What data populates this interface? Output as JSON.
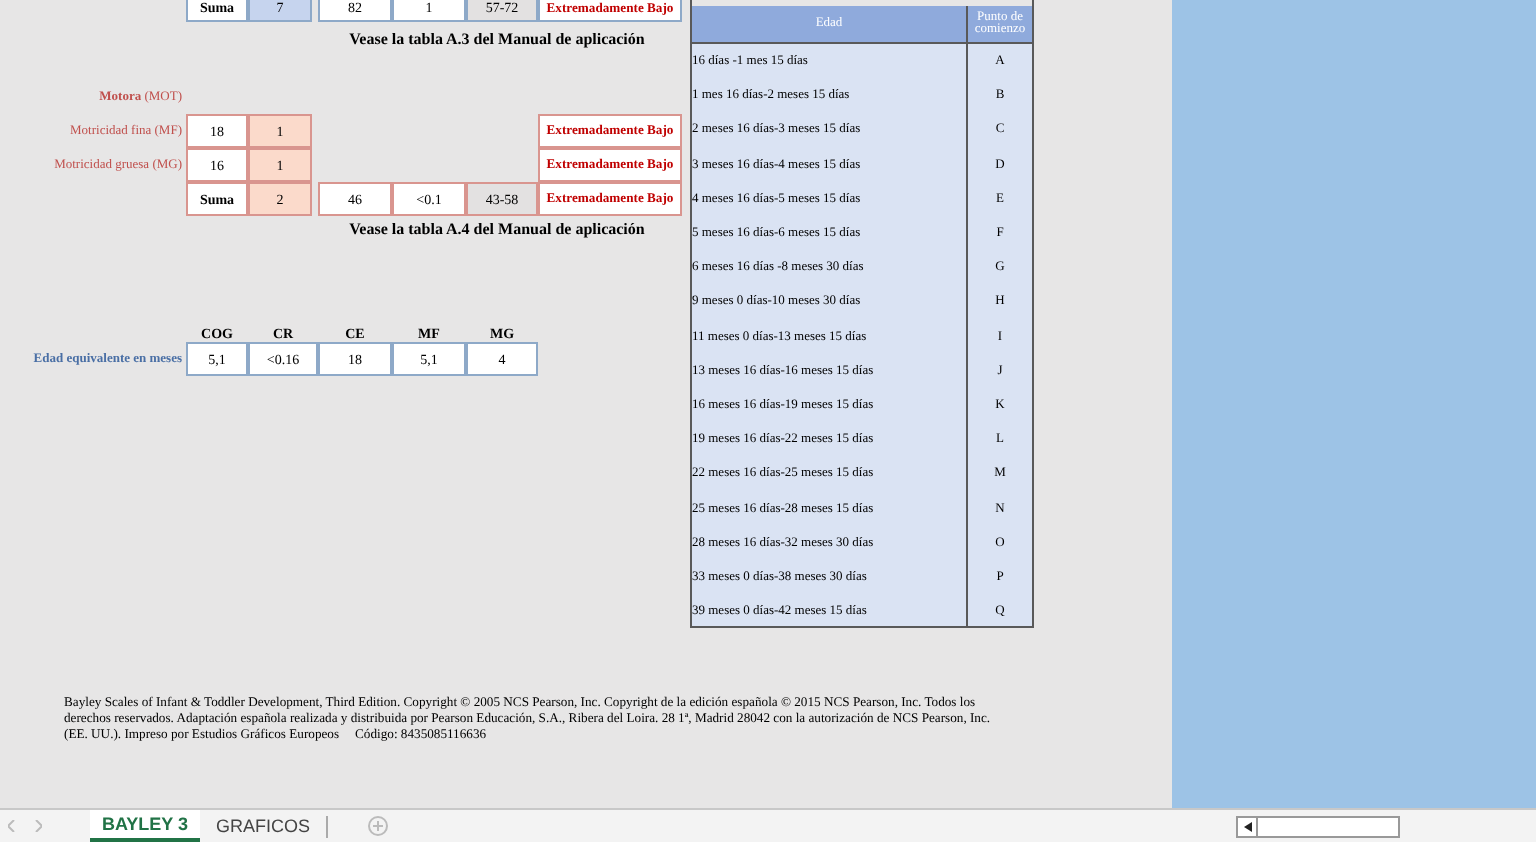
{
  "score_top": {
    "sum_label": "Suma",
    "sum_value": "7",
    "cells": [
      "82",
      "1",
      "57-72"
    ],
    "classification": "Extremadamente Bajo",
    "note": "Vease la tabla A.3 del Manual de aplicación"
  },
  "motor": {
    "title": "**Motora** (MOT)",
    "rows": [
      {
        "label": "Motricidad fina (MF)",
        "raw": "18",
        "scaled": "1",
        "classification": "Extremadamente Bajo"
      },
      {
        "label": "Motricidad gruesa (MG)",
        "raw": "16",
        "scaled": "1",
        "classification": "Extremadamente Bajo"
      }
    ],
    "sum": {
      "label": "Suma",
      "value": "2",
      "cells": [
        "46",
        "<0.1",
        "43-58"
      ],
      "classification": "Extremadamente Bajo"
    },
    "note": "Vease la tabla A.4 del Manual de aplicación"
  },
  "age_equivalent": {
    "label": "Edad equivalente en meses",
    "columns": [
      "COG",
      "CR",
      "CE",
      "MF",
      "MG"
    ],
    "values": [
      "5,1",
      "<0.16",
      "18",
      "5,1",
      "4"
    ]
  },
  "age_table": {
    "columns": [
      "Edad",
      "Punto de comienzo"
    ],
    "rows": [
      [
        "16 días -1 mes 15 días",
        "A"
      ],
      [
        "1 mes 16 días-2 meses 15 días",
        "B"
      ],
      [
        "2 meses 16 días-3 meses 15 días",
        "C"
      ],
      [
        "3 meses 16 días-4 meses 15 días",
        "D"
      ],
      [
        "4 meses 16 días-5 meses 15 días",
        "E"
      ],
      [
        "5 meses 16 días-6 meses 15 días",
        "F"
      ],
      [
        "6 meses 16 días -8 meses 30 días",
        "G"
      ],
      [
        "9 meses 0 días-10 meses 30 días",
        "H"
      ],
      [
        "11 meses 0 días-13 meses 15 días",
        "I"
      ],
      [
        "13 meses 16 días-16 meses 15 días",
        "J"
      ],
      [
        "16 meses 16 días-19 meses 15 días",
        "K"
      ],
      [
        "19 meses 16 días-22 meses 15 días",
        "L"
      ],
      [
        "22 meses 16 días-25 meses 15 días",
        "M"
      ],
      [
        "25 meses 16 días-28 meses 15 días",
        "N"
      ],
      [
        "28 meses 16 días-32 meses 30 días",
        "O"
      ],
      [
        "33 meses 0 días-38 meses 30 días",
        "P"
      ],
      [
        "39 meses 0 días-42 meses 15 días",
        "Q"
      ]
    ]
  },
  "footer": {
    "copyright": "Bayley Scales of Infant & Toddler Development, Third Edition. Copyright © 2005 NCS Pearson, Inc. Copyright de la edición española © 2015 NCS Pearson, Inc. Todos los derechos reservados. Adaptación española realizada y distribuida por Pearson Educación, S.A., Ribera del Loira. 28 1ª, Madrid 28042 con la autorización de NCS Pearson, Inc. (EE. UU.).",
    "printer": "Impreso por Estudios Gráficos Europeos",
    "code": "Código: 8435085116636"
  },
  "sheet_tabs": [
    {
      "label": "BAYLEY 3",
      "selected": true
    },
    {
      "label": "GRAFICOS",
      "selected": false
    }
  ]
}
